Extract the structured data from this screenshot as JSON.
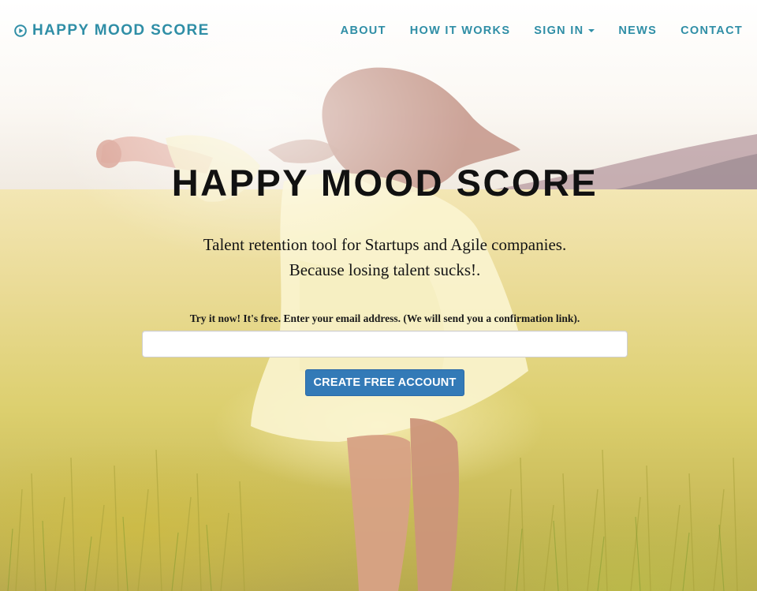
{
  "nav": {
    "brand": "HAPPY MOOD SCORE",
    "brand_icon": "play-circle-icon",
    "items": [
      {
        "label": "ABOUT"
      },
      {
        "label": "HOW IT WORKS"
      },
      {
        "label": "SIGN IN",
        "has_dropdown": true
      },
      {
        "label": "NEWS"
      },
      {
        "label": "CONTACT"
      }
    ]
  },
  "hero": {
    "title": "HAPPY MOOD SCORE",
    "tagline_line1": "Talent retention tool for Startups and Agile companies.",
    "tagline_line2": "Because losing talent sucks!.",
    "signup_prompt": "Try it now! It's free. Enter your email address. (We will send you a confirmation link).",
    "email_value": "",
    "email_placeholder": "",
    "cta_label": "CREATE FREE ACCOUNT"
  },
  "colors": {
    "brand": "#2f8ea6",
    "cta": "#337ab7",
    "title": "#111111"
  }
}
